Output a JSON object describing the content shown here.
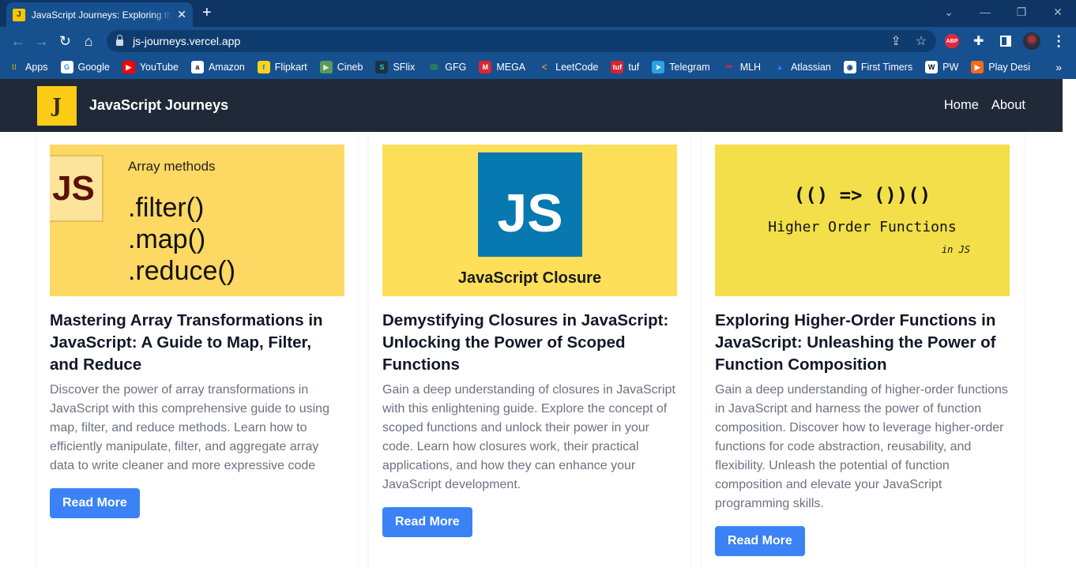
{
  "browser": {
    "tab": {
      "favicon": "J",
      "title": "JavaScript Journeys: Exploring the Power of JavaScript",
      "close": "✕"
    },
    "new_tab": "+",
    "window_controls": {
      "tab_search": "⌄",
      "minimize": "—",
      "restore": "❐",
      "close": "✕"
    },
    "nav": {
      "back": "←",
      "forward": "→",
      "reload": "↻",
      "home": "⌂"
    },
    "url": "js-journeys.vercel.app",
    "omni_icons": {
      "share": "⇪",
      "bookmark": "☆"
    },
    "extensions": {
      "abp": "ABP",
      "puzzle": "✚",
      "menu": "⋮"
    },
    "bookmarks": [
      {
        "label": "Apps",
        "icon": "apps-grid-icon",
        "glyph": "⁞⁞",
        "bg": "transparent",
        "fg": "#f4b400"
      },
      {
        "label": "Google",
        "icon": "google-icon",
        "glyph": "G",
        "bg": "#ffffff",
        "fg": "#4285f4"
      },
      {
        "label": "YouTube",
        "icon": "youtube-icon",
        "glyph": "▶",
        "bg": "#ff0000",
        "fg": "#ffffff"
      },
      {
        "label": "Amazon",
        "icon": "amazon-icon",
        "glyph": "a",
        "bg": "#ffffff",
        "fg": "#111111"
      },
      {
        "label": "Flipkart",
        "icon": "flipkart-icon",
        "glyph": "f",
        "bg": "#f8d41c",
        "fg": "#2874f0"
      },
      {
        "label": "Cineb",
        "icon": "cineb-icon",
        "glyph": "▶",
        "bg": "#5a9a5a",
        "fg": "#d8f0d8"
      },
      {
        "label": "SFlix",
        "icon": "sflix-icon",
        "glyph": "S",
        "bg": "#1d3140",
        "fg": "#28d1c0"
      },
      {
        "label": "GFG",
        "icon": "gfg-icon",
        "glyph": "ↂ",
        "bg": "transparent",
        "fg": "#2f8d46"
      },
      {
        "label": "MEGA",
        "icon": "mega-icon",
        "glyph": "M",
        "bg": "#d9272e",
        "fg": "#ffffff"
      },
      {
        "label": "LeetCode",
        "icon": "leetcode-icon",
        "glyph": "ᐸ",
        "bg": "transparent",
        "fg": "#f89f1b"
      },
      {
        "label": "tuf",
        "icon": "tuf-icon",
        "glyph": "tuf",
        "bg": "#d9232d",
        "fg": "#ffffff"
      },
      {
        "label": "Telegram",
        "icon": "telegram-icon",
        "glyph": "➤",
        "bg": "#2aa3df",
        "fg": "#ffffff"
      },
      {
        "label": "MLH",
        "icon": "mlh-icon",
        "glyph": "ᵐʰ",
        "bg": "transparent",
        "fg": "#e73427"
      },
      {
        "label": "Atlassian",
        "icon": "atlassian-icon",
        "glyph": "▲",
        "bg": "transparent",
        "fg": "#2684ff"
      },
      {
        "label": "First Timers",
        "icon": "globe-icon",
        "glyph": "◉",
        "bg": "#ffffff",
        "fg": "#17508f"
      },
      {
        "label": "PW",
        "icon": "pw-icon",
        "glyph": "W",
        "bg": "#ffffff",
        "fg": "#111111"
      },
      {
        "label": "Play Desi",
        "icon": "play-desi-icon",
        "glyph": "▶",
        "bg": "#f26b1d",
        "fg": "#ffffff"
      }
    ],
    "bookmarks_more": "»"
  },
  "site": {
    "logo": "J",
    "brand": "JavaScript Journeys",
    "nav": [
      "Home",
      "About"
    ]
  },
  "posts": [
    {
      "image": {
        "badge": "JS",
        "heading": "Array methods",
        "lines": [
          ".filter()",
          ".map()",
          ".reduce()"
        ]
      },
      "title": "Mastering Array Transformations in JavaScript: A Guide to Map, Filter, and Reduce",
      "description": "Discover the power of array transformations in JavaScript with this comprehensive guide to using map, filter, and reduce methods. Learn how to efficiently manipulate, filter, and aggregate array data to write cleaner and more expressive code",
      "button": "Read More"
    },
    {
      "image": {
        "badge": "JS",
        "caption": "JavaScript Closure"
      },
      "title": "Demystifying Closures in JavaScript: Unlocking the Power of Scoped Functions",
      "description": "Gain a deep understanding of closures in JavaScript with this enlightening guide. Explore the concept of scoped functions and unlock their power in your code. Learn how closures work, their practical applications, and how they can enhance your JavaScript development.",
      "button": "Read More"
    },
    {
      "image": {
        "code": "(() => ())()",
        "heading": "Higher Order Functions",
        "sub": "in JS"
      },
      "title": "Exploring Higher-Order Functions in JavaScript: Unleashing the Power of Function Composition",
      "description": "Gain a deep understanding of higher-order functions in JavaScript and harness the power of function composition. Discover how to leverage higher-order functions for code abstraction, reusability, and flexibility. Unleash the potential of function composition and elevate your JavaScript programming skills.",
      "button": "Read More"
    }
  ]
}
